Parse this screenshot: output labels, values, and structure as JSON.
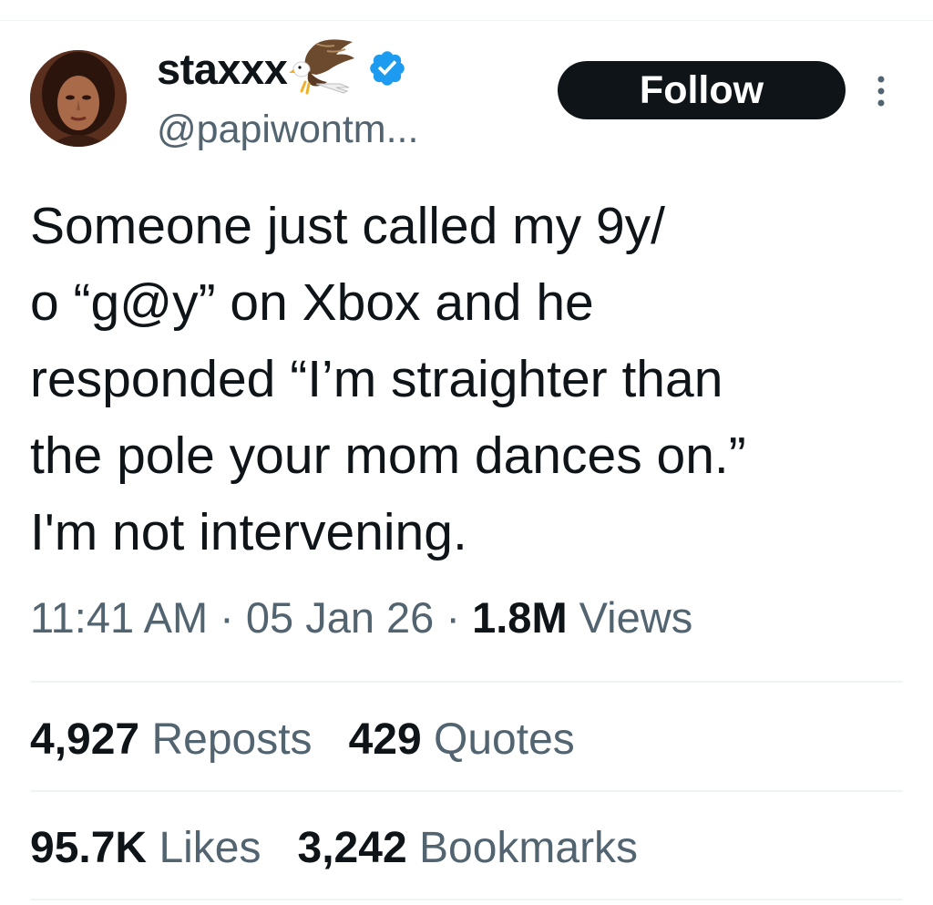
{
  "user": {
    "display_name": "staxxx",
    "name_emoji_icon": "eagle-icon",
    "verified_icon": "verified-badge-icon",
    "handle": "@papiwontm..."
  },
  "actions": {
    "follow_label": "Follow",
    "more_icon": "more-vertical-icon"
  },
  "tweet": {
    "text": "Someone just called my 9y/\no “g@y” on Xbox and he\nresponded “I’m straighter than\nthe pole your mom dances on.”\nI'm not intervening."
  },
  "meta": {
    "time": "11:41 AM",
    "separator": "·",
    "date": "05 Jan 26",
    "views_count": "1.8M",
    "views_label": "Views"
  },
  "stats": {
    "reposts_count": "4,927",
    "reposts_label": "Reposts",
    "quotes_count": "429",
    "quotes_label": "Quotes",
    "likes_count": "95.7K",
    "likes_label": "Likes",
    "bookmarks_count": "3,242",
    "bookmarks_label": "Bookmarks"
  },
  "colors": {
    "text_primary": "#0f1419",
    "text_secondary": "#536471",
    "verified_blue": "#1d9bf0",
    "follow_bg": "#0f1419",
    "divider": "#eff3f4"
  }
}
